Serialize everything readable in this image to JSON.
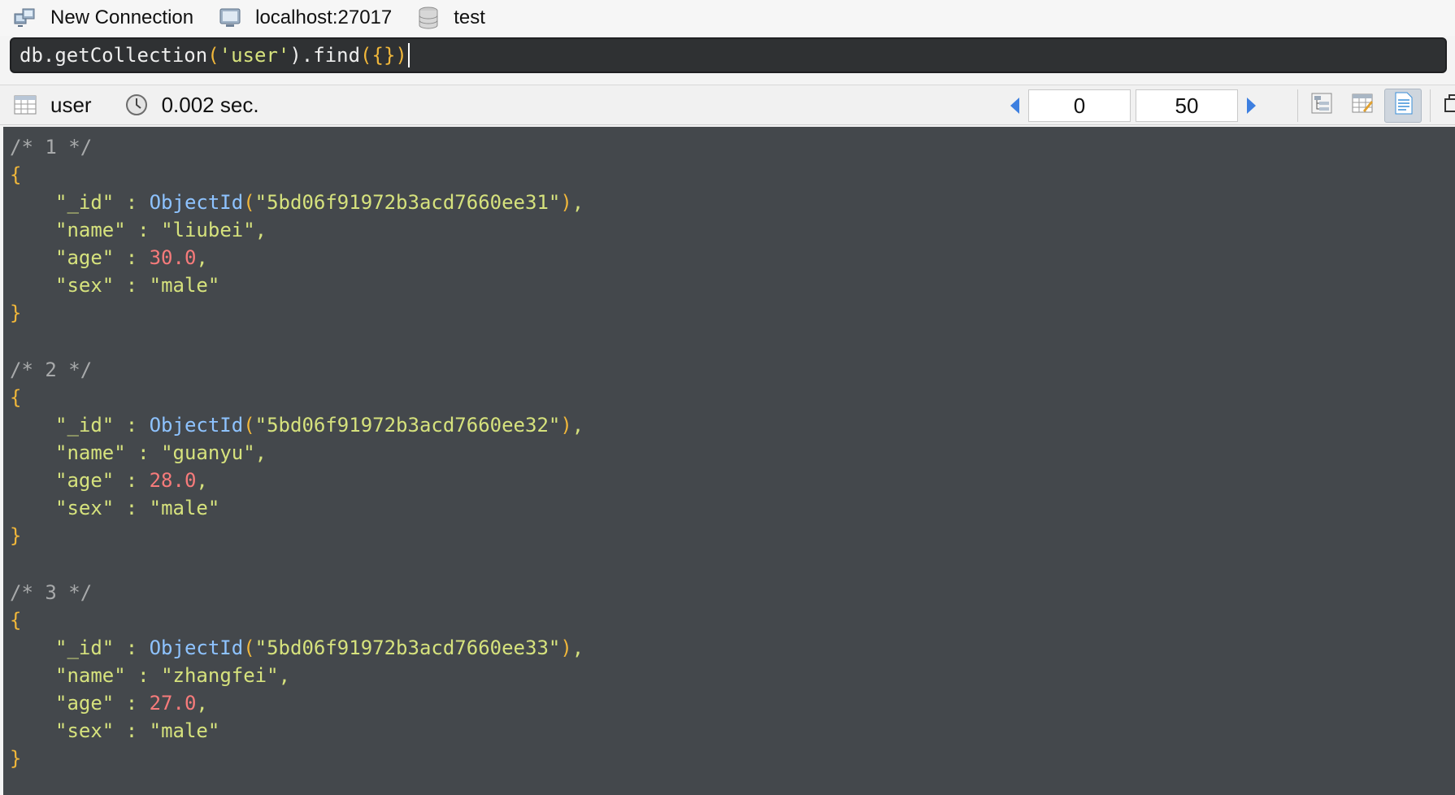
{
  "connection_bar": {
    "connection": {
      "label": "New Connection",
      "icon": "connection-icon"
    },
    "host": {
      "label": "localhost:27017",
      "icon": "server-icon"
    },
    "database": {
      "label": "test",
      "icon": "database-icon"
    }
  },
  "query": {
    "prefix": "db.getCollection",
    "open_paren": "(",
    "arg": "'user'",
    "close_paren": ").find",
    "find_open": "(",
    "find_arg": "{}",
    "find_close": ")"
  },
  "results_toolbar": {
    "collection": {
      "label": "user",
      "icon": "table-icon"
    },
    "time": {
      "label": "0.002 sec.",
      "icon": "clock-icon"
    },
    "skip_value": "0",
    "limit_value": "50",
    "view_modes": [
      "tree-view",
      "table-view",
      "text-view"
    ],
    "active_view": "text-view"
  },
  "documents": [
    {
      "comment": "/* 1 */",
      "id": "5bd06f91972b3acd7660ee31",
      "name": "liubei",
      "age": "30.0",
      "sex": "male"
    },
    {
      "comment": "/* 2 */",
      "id": "5bd06f91972b3acd7660ee32",
      "name": "guanyu",
      "age": "28.0",
      "sex": "male"
    },
    {
      "comment": "/* 3 */",
      "id": "5bd06f91972b3acd7660ee33",
      "name": "zhangfei",
      "age": "27.0",
      "sex": "male"
    }
  ],
  "colors": {
    "editor_bg": "#44484c",
    "key": "#d6e27d",
    "number": "#f77b7b",
    "function": "#8ec3ff",
    "brace": "#f1b73a",
    "comment": "#a8aaab"
  }
}
